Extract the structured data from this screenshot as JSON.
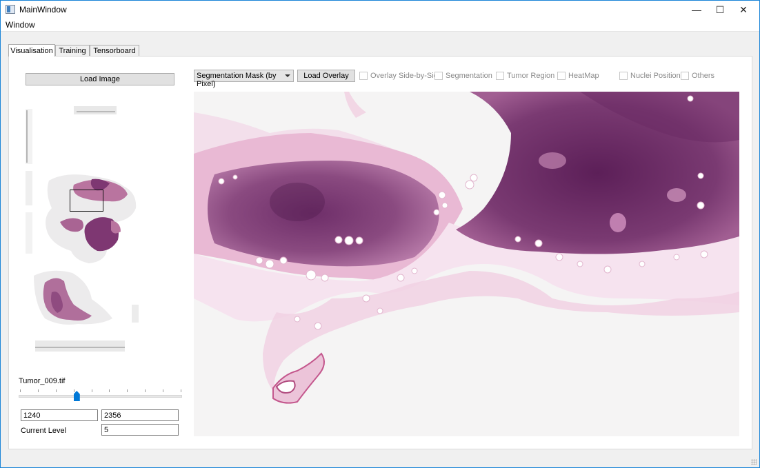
{
  "window": {
    "title": "MainWindow",
    "controls": {
      "minimize": "—",
      "maximize": "☐",
      "close": "✕"
    }
  },
  "menu": {
    "items": [
      "Window"
    ]
  },
  "tabs": [
    "Visualisation",
    "Training",
    "Tensorboard"
  ],
  "left": {
    "load_image_label": "Load Image",
    "file_name": "Tumor_009.tif",
    "coord_x": "1240",
    "coord_y": "2356",
    "current_level_label": "Current Level",
    "current_level": "5",
    "slider": {
      "ticks": 10,
      "position_fraction": 0.35
    }
  },
  "toolbar": {
    "overlay_mode": "Segmentation Mask (by Pixel)",
    "load_overlay_label": "Load Overlay",
    "checkboxes": [
      "Overlay Side-by-Side",
      "Segmentation",
      "Tumor Region",
      "HeatMap",
      "Nuclei Position",
      "Others"
    ]
  },
  "colors": {
    "accent": "#0078d7",
    "tissue_dark": "#6a2a64",
    "tissue_light": "#c98fb8"
  }
}
